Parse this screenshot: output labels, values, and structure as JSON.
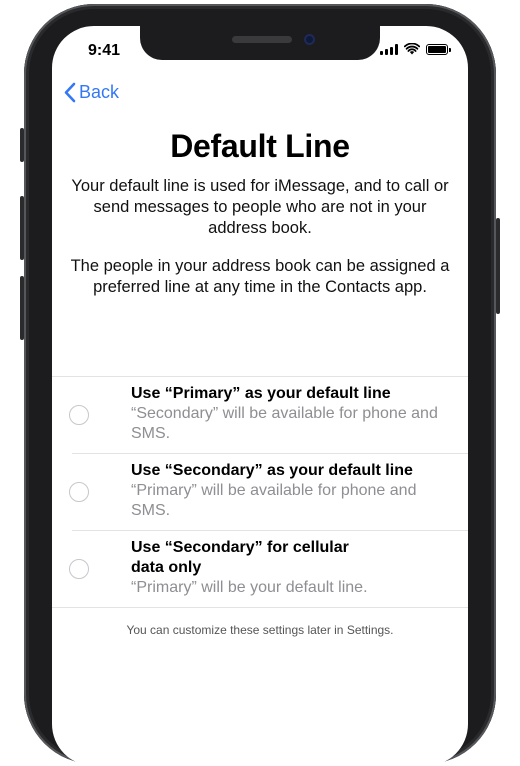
{
  "status_bar": {
    "time": "9:41"
  },
  "nav": {
    "back_label": "Back"
  },
  "page": {
    "title": "Default Line",
    "paragraphs": [
      "Your default line is used for iMessage, and to call or send messages to people who are not in your address book.",
      "The people in your address book can be assigned a preferred line at any time in the Contacts app."
    ]
  },
  "options": [
    {
      "title": "Use “Primary” as your default line",
      "subtitle": "“Secondary” will be available for phone and SMS.",
      "selected": false
    },
    {
      "title": "Use “Secondary” as your default line",
      "subtitle": "“Primary” will be available for phone and SMS.",
      "selected": false
    },
    {
      "title": "Use “Secondary” for cellular data only",
      "subtitle": "“Primary” will be your default line.",
      "selected": false
    }
  ],
  "footer": {
    "note": "You can customize these settings later in Settings."
  },
  "colors": {
    "accent": "#3478f6",
    "secondary_text": "#8e8e93",
    "separator": "#e3e3e6",
    "frame": "#1c1c1e"
  },
  "icons": [
    "chevron-left-icon",
    "signal-icon",
    "wifi-icon",
    "battery-icon",
    "camera-icon"
  ]
}
